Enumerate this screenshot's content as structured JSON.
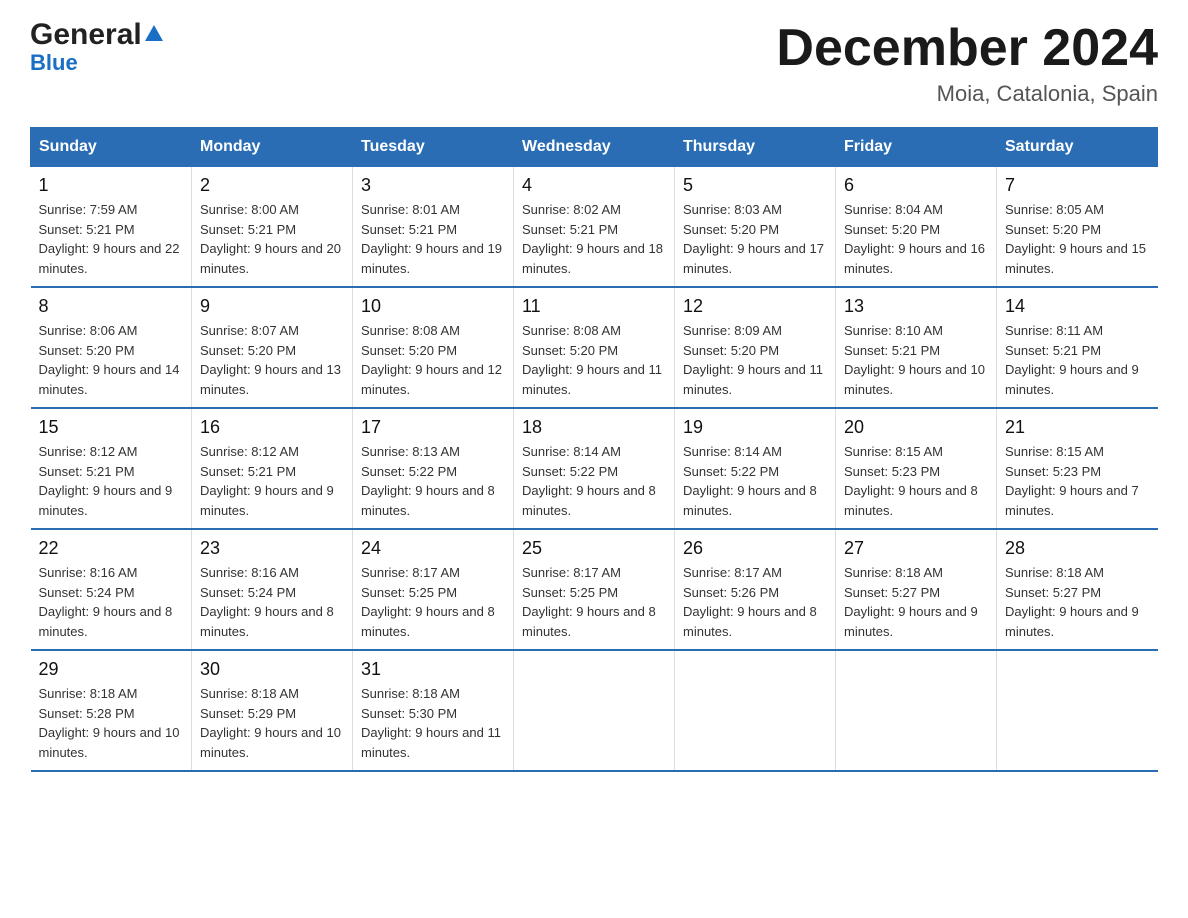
{
  "logo": {
    "name_part1": "General",
    "name_part2": "Blue"
  },
  "header": {
    "title": "December 2024",
    "subtitle": "Moia, Catalonia, Spain"
  },
  "days_of_week": [
    "Sunday",
    "Monday",
    "Tuesday",
    "Wednesday",
    "Thursday",
    "Friday",
    "Saturday"
  ],
  "weeks": [
    [
      {
        "day": "1",
        "sunrise": "7:59 AM",
        "sunset": "5:21 PM",
        "daylight": "9 hours and 22 minutes."
      },
      {
        "day": "2",
        "sunrise": "8:00 AM",
        "sunset": "5:21 PM",
        "daylight": "9 hours and 20 minutes."
      },
      {
        "day": "3",
        "sunrise": "8:01 AM",
        "sunset": "5:21 PM",
        "daylight": "9 hours and 19 minutes."
      },
      {
        "day": "4",
        "sunrise": "8:02 AM",
        "sunset": "5:21 PM",
        "daylight": "9 hours and 18 minutes."
      },
      {
        "day": "5",
        "sunrise": "8:03 AM",
        "sunset": "5:20 PM",
        "daylight": "9 hours and 17 minutes."
      },
      {
        "day": "6",
        "sunrise": "8:04 AM",
        "sunset": "5:20 PM",
        "daylight": "9 hours and 16 minutes."
      },
      {
        "day": "7",
        "sunrise": "8:05 AM",
        "sunset": "5:20 PM",
        "daylight": "9 hours and 15 minutes."
      }
    ],
    [
      {
        "day": "8",
        "sunrise": "8:06 AM",
        "sunset": "5:20 PM",
        "daylight": "9 hours and 14 minutes."
      },
      {
        "day": "9",
        "sunrise": "8:07 AM",
        "sunset": "5:20 PM",
        "daylight": "9 hours and 13 minutes."
      },
      {
        "day": "10",
        "sunrise": "8:08 AM",
        "sunset": "5:20 PM",
        "daylight": "9 hours and 12 minutes."
      },
      {
        "day": "11",
        "sunrise": "8:08 AM",
        "sunset": "5:20 PM",
        "daylight": "9 hours and 11 minutes."
      },
      {
        "day": "12",
        "sunrise": "8:09 AM",
        "sunset": "5:20 PM",
        "daylight": "9 hours and 11 minutes."
      },
      {
        "day": "13",
        "sunrise": "8:10 AM",
        "sunset": "5:21 PM",
        "daylight": "9 hours and 10 minutes."
      },
      {
        "day": "14",
        "sunrise": "8:11 AM",
        "sunset": "5:21 PM",
        "daylight": "9 hours and 9 minutes."
      }
    ],
    [
      {
        "day": "15",
        "sunrise": "8:12 AM",
        "sunset": "5:21 PM",
        "daylight": "9 hours and 9 minutes."
      },
      {
        "day": "16",
        "sunrise": "8:12 AM",
        "sunset": "5:21 PM",
        "daylight": "9 hours and 9 minutes."
      },
      {
        "day": "17",
        "sunrise": "8:13 AM",
        "sunset": "5:22 PM",
        "daylight": "9 hours and 8 minutes."
      },
      {
        "day": "18",
        "sunrise": "8:14 AM",
        "sunset": "5:22 PM",
        "daylight": "9 hours and 8 minutes."
      },
      {
        "day": "19",
        "sunrise": "8:14 AM",
        "sunset": "5:22 PM",
        "daylight": "9 hours and 8 minutes."
      },
      {
        "day": "20",
        "sunrise": "8:15 AM",
        "sunset": "5:23 PM",
        "daylight": "9 hours and 8 minutes."
      },
      {
        "day": "21",
        "sunrise": "8:15 AM",
        "sunset": "5:23 PM",
        "daylight": "9 hours and 7 minutes."
      }
    ],
    [
      {
        "day": "22",
        "sunrise": "8:16 AM",
        "sunset": "5:24 PM",
        "daylight": "9 hours and 8 minutes."
      },
      {
        "day": "23",
        "sunrise": "8:16 AM",
        "sunset": "5:24 PM",
        "daylight": "9 hours and 8 minutes."
      },
      {
        "day": "24",
        "sunrise": "8:17 AM",
        "sunset": "5:25 PM",
        "daylight": "9 hours and 8 minutes."
      },
      {
        "day": "25",
        "sunrise": "8:17 AM",
        "sunset": "5:25 PM",
        "daylight": "9 hours and 8 minutes."
      },
      {
        "day": "26",
        "sunrise": "8:17 AM",
        "sunset": "5:26 PM",
        "daylight": "9 hours and 8 minutes."
      },
      {
        "day": "27",
        "sunrise": "8:18 AM",
        "sunset": "5:27 PM",
        "daylight": "9 hours and 9 minutes."
      },
      {
        "day": "28",
        "sunrise": "8:18 AM",
        "sunset": "5:27 PM",
        "daylight": "9 hours and 9 minutes."
      }
    ],
    [
      {
        "day": "29",
        "sunrise": "8:18 AM",
        "sunset": "5:28 PM",
        "daylight": "9 hours and 10 minutes."
      },
      {
        "day": "30",
        "sunrise": "8:18 AM",
        "sunset": "5:29 PM",
        "daylight": "9 hours and 10 minutes."
      },
      {
        "day": "31",
        "sunrise": "8:18 AM",
        "sunset": "5:30 PM",
        "daylight": "9 hours and 11 minutes."
      },
      null,
      null,
      null,
      null
    ]
  ],
  "labels": {
    "sunrise": "Sunrise:",
    "sunset": "Sunset:",
    "daylight": "Daylight:"
  }
}
